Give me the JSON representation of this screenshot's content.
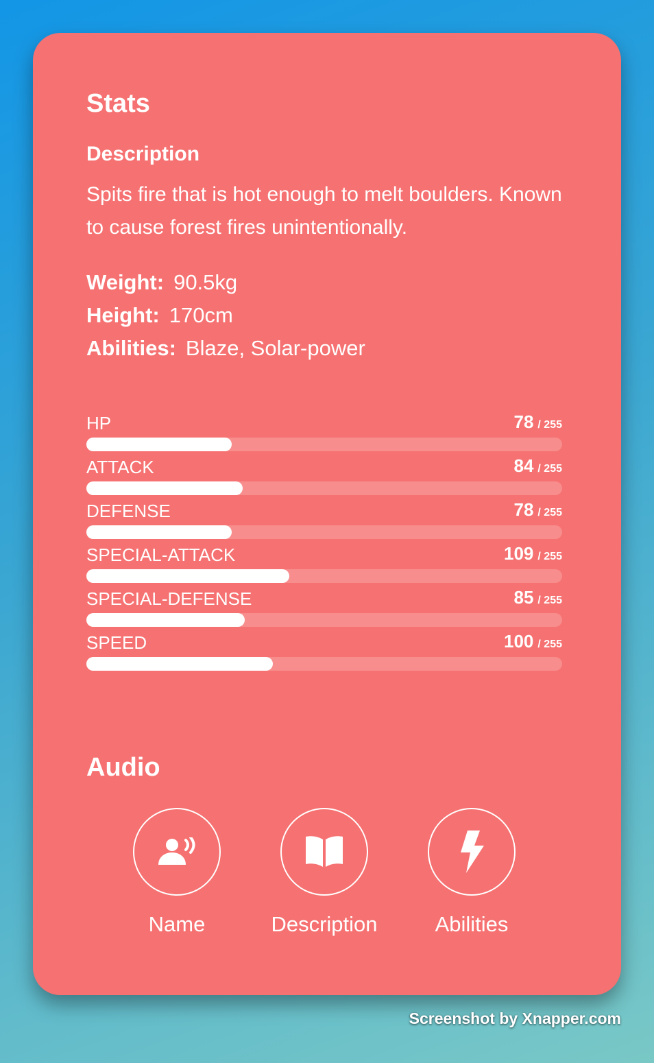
{
  "colors": {
    "card": "#f67171",
    "bar_fill": "#ffffff"
  },
  "stats_section": {
    "title": "Stats",
    "description_heading": "Description",
    "description": "Spits fire that is hot enough to melt boulders. Known to cause forest fires unintentionally.",
    "weight_label": "Weight:",
    "weight_value": "90.5kg",
    "height_label": "Height:",
    "height_value": "170cm",
    "abilities_label": "Abilities:",
    "abilities_value": "Blaze, Solar-power",
    "max_label": "/ 255",
    "max_value": 255,
    "items": [
      {
        "name": "HP",
        "value": "78",
        "percent": 30.6
      },
      {
        "name": "ATTACK",
        "value": "84",
        "percent": 32.9
      },
      {
        "name": "DEFENSE",
        "value": "78",
        "percent": 30.6
      },
      {
        "name": "SPECIAL-ATTACK",
        "value": "109",
        "percent": 42.7
      },
      {
        "name": "SPECIAL-DEFENSE",
        "value": "85",
        "percent": 33.3
      },
      {
        "name": "SPEED",
        "value": "100",
        "percent": 39.2
      }
    ]
  },
  "audio_section": {
    "title": "Audio",
    "buttons": [
      {
        "label": "Name",
        "icon": "speaking-person-icon"
      },
      {
        "label": "Description",
        "icon": "book-open-icon"
      },
      {
        "label": "Abilities",
        "icon": "lightning-bolt-icon"
      }
    ]
  },
  "watermark": "Screenshot by Xnapper.com"
}
